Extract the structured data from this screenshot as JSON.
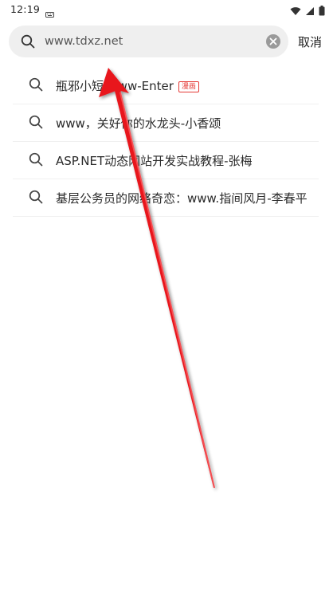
{
  "status_bar": {
    "time": "12:19",
    "icons": [
      "keyboard-icon",
      "wifi-icon",
      "signal-icon",
      "battery-icon"
    ]
  },
  "search": {
    "value": "www.tdxz.net",
    "placeholder": "",
    "cancel_label": "取消"
  },
  "suggestions": [
    {
      "text": "瓶邪小短-www-Enter",
      "tag": "漫画"
    },
    {
      "text": "www，关好你的水龙头-小香颂",
      "tag": ""
    },
    {
      "text": "ASP.NET动态网站开发实战教程-张梅",
      "tag": ""
    },
    {
      "text": "基层公务员的网络奇恋：www.指间风月-李春平",
      "tag": ""
    }
  ],
  "colors": {
    "search_bg": "#efefef",
    "tag_red": "#e53935",
    "annotation_arrow": "#e8141c"
  }
}
